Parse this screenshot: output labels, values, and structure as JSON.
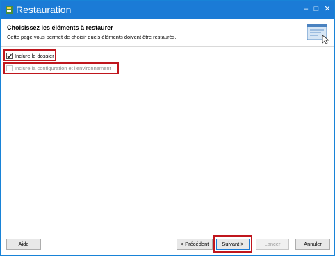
{
  "window": {
    "title": "Restauration"
  },
  "titlebar": {
    "minimize_glyph": "–",
    "maximize_glyph": "□",
    "close_glyph": "✕"
  },
  "header": {
    "title": "Choisissez les éléments à restaurer",
    "description": "Cette page vous permet de choisir quels éléments doivent être restaurés.",
    "art_icon": "window-cursor-icon"
  },
  "options": [
    {
      "label": "Inclure le dossier",
      "checked": true,
      "enabled": true
    },
    {
      "label": "Inclure la configuration et l'environnement",
      "checked": false,
      "enabled": false
    }
  ],
  "buttons": {
    "help": "Aide",
    "previous": "< Précédent",
    "next": "Suivant >",
    "launch": "Lancer",
    "cancel": "Annuler"
  },
  "colors": {
    "titlebar": "#1b7bd6",
    "highlight": "#c0161d"
  }
}
